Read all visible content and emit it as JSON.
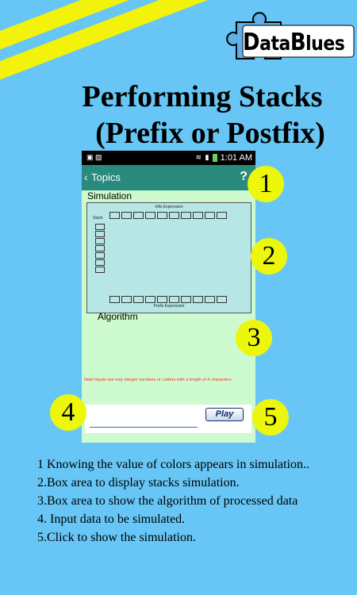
{
  "logo": {
    "text_first": "D",
    "text_mid": "ata",
    "text_b": "B",
    "text_end": "lues"
  },
  "headline": {
    "line1": "Performing Stacks",
    "line2": "(Prefix or Postfix)"
  },
  "phone": {
    "status_time": "1:01 AM",
    "appbar_back": "‹",
    "appbar_title": "Topics",
    "appbar_help": "?",
    "simulation_label": "Simulation",
    "infix_label": "Infix Expression",
    "stack_label": "Stack",
    "prefix_label": "Prefix Expression",
    "algorithm_label": "Algorithm",
    "note": "Note:Inputs are only integer numbers or Letters with a length of 4 characters",
    "play_label": "Play",
    "input_value": ""
  },
  "markers": [
    "1",
    "2",
    "3",
    "4",
    "5"
  ],
  "descriptions": [
    "1 Knowing the value of colors appears in simulation..",
    "2.Box area to display stacks simulation.",
    "3.Box area to show the algorithm of processed data",
    "4. Input data to be simulated.",
    "5.Click to show the simulation."
  ],
  "colors": {
    "background": "#67c6f5",
    "stripe": "#f2f20a",
    "appbar": "#2a8a7e",
    "marker": "#ecf70c",
    "phone_bg": "#cdfacf"
  }
}
